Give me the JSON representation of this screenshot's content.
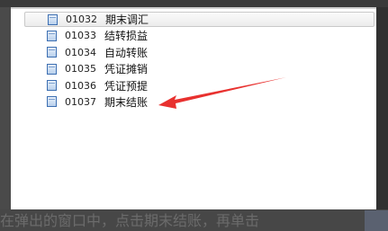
{
  "caption": {
    "text": "在弹出的窗口中，点击期末结账，再单击"
  },
  "list": {
    "items": [
      {
        "code": "01032",
        "name": "期末调汇"
      },
      {
        "code": "01033",
        "name": "结转损益"
      },
      {
        "code": "01034",
        "name": "自动转账"
      },
      {
        "code": "01035",
        "name": "凭证摊销"
      },
      {
        "code": "01036",
        "name": "凭证预提"
      },
      {
        "code": "01037",
        "name": "期末结账"
      }
    ]
  },
  "annotation": {
    "arrow_color": "#e8312f"
  }
}
